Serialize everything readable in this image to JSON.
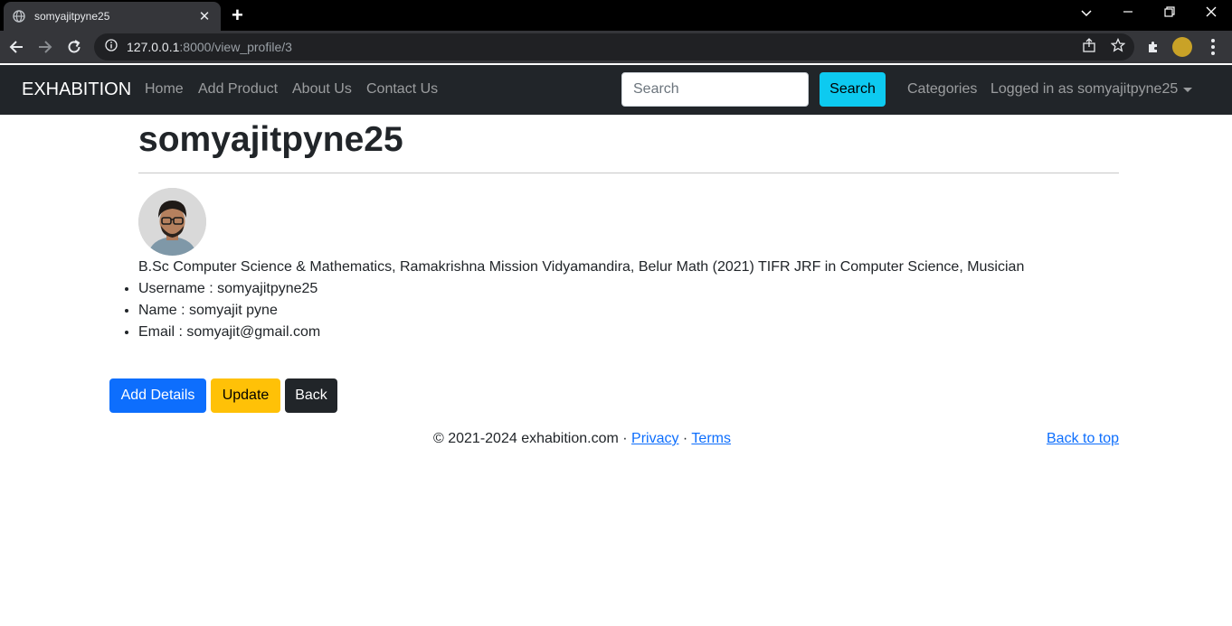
{
  "browser": {
    "tab_title": "somyajitpyne25",
    "url_host": "127.0.0.1",
    "url_rest": ":8000/view_profile/3"
  },
  "navbar": {
    "brand": "EXHABITION",
    "links": [
      "Home",
      "Add Product",
      "About Us",
      "Contact Us"
    ],
    "search_placeholder": "Search",
    "search_button": "Search",
    "categories": "Categories",
    "user_menu": "Logged in as somyajitpyne25"
  },
  "profile": {
    "title": "somyajitpyne25",
    "bio": "B.Sc Computer Science & Mathematics, Ramakrishna Mission Vidyamandira, Belur Math (2021) TIFR JRF in Computer Science, Musician",
    "details": [
      "Username : somyajitpyne25",
      "Name : somyajit pyne",
      "Email : somyajit@gmail.com"
    ]
  },
  "actions": {
    "add_details": "Add Details",
    "update": "Update",
    "back": "Back"
  },
  "footer": {
    "copyright": "© 2021-2024 exhabition.com · ",
    "privacy": "Privacy",
    "separator": " · ",
    "terms": "Terms",
    "back_to_top": "Back to top"
  },
  "colors": {
    "navbar_bg": "#212529",
    "search_btn": "#0dcaf0",
    "primary": "#0d6efd",
    "warning": "#ffc107",
    "dark": "#212529"
  }
}
